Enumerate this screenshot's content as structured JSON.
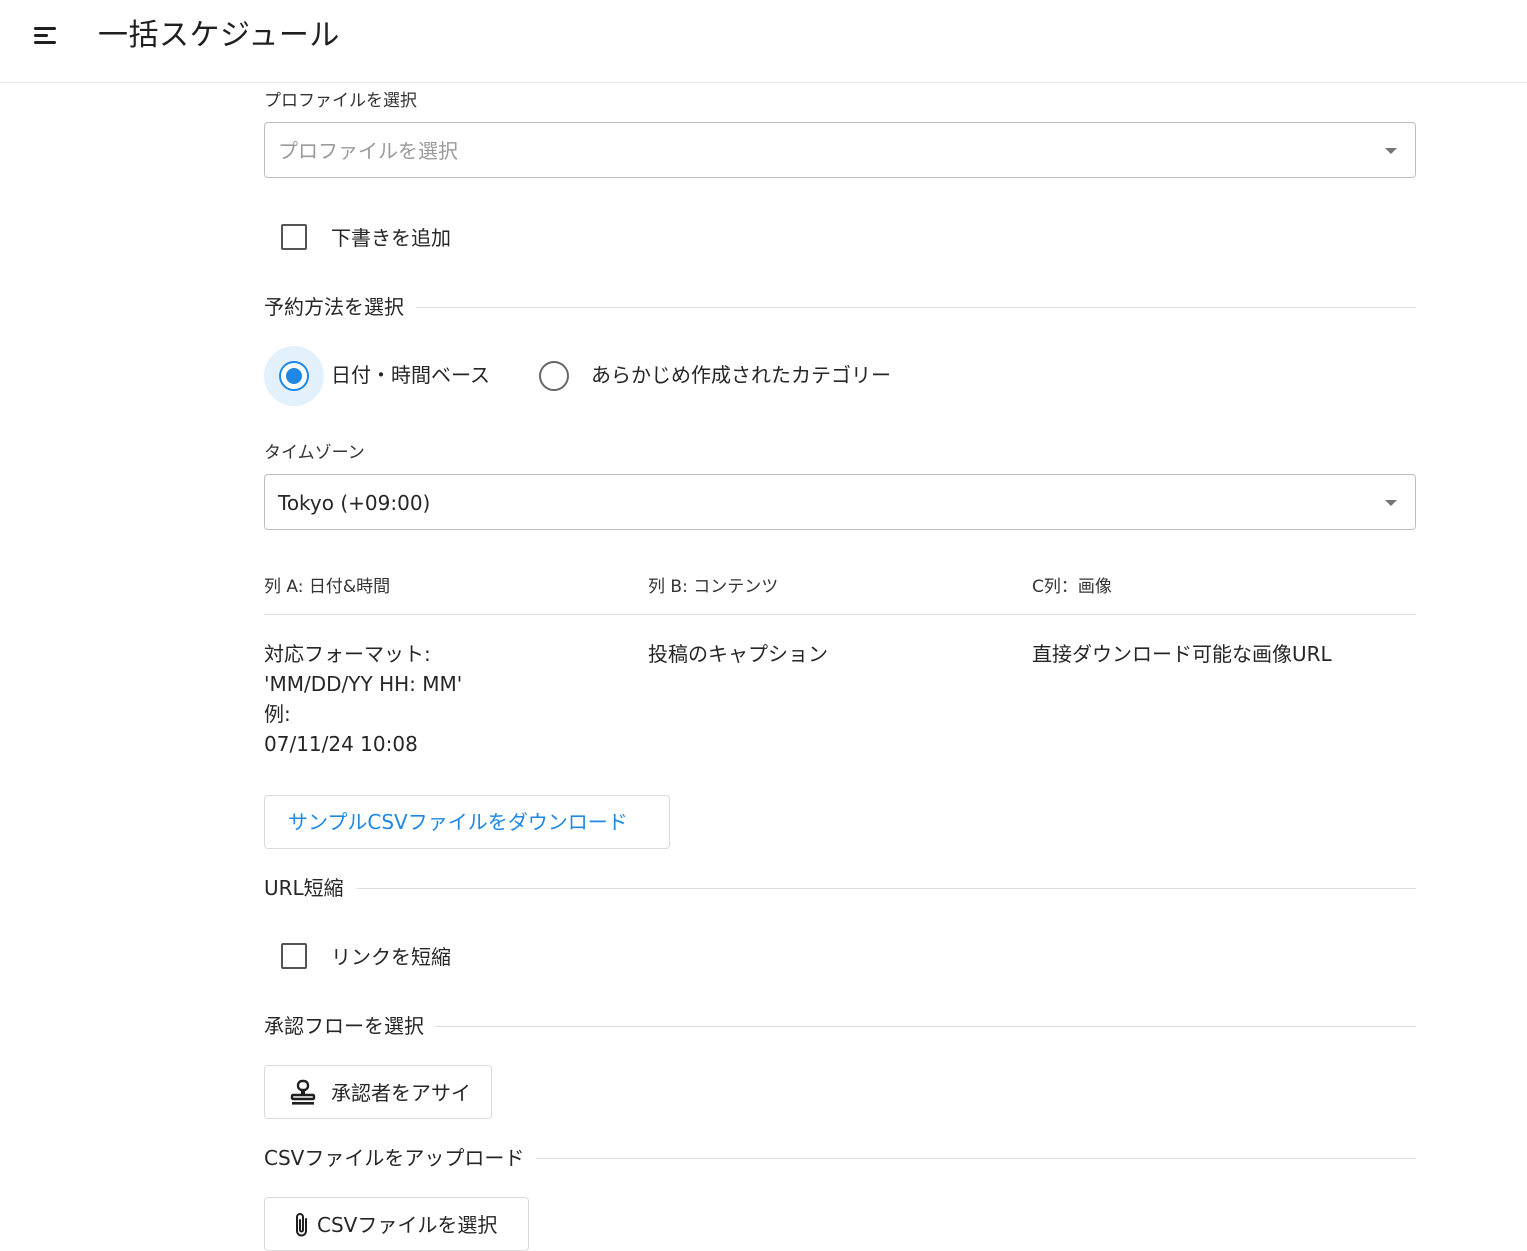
{
  "header": {
    "title": "一括スケジュール",
    "menu_icon": "menu-icon"
  },
  "profile": {
    "label": "プロファイルを選択",
    "placeholder": "プロファイルを選択"
  },
  "draft": {
    "label": "下書きを追加",
    "checked": false
  },
  "schedule_method": {
    "title": "予約方法を選択",
    "options": [
      {
        "label": "日付・時間ベース",
        "selected": true
      },
      {
        "label": "あらかじめ作成されたカテゴリー",
        "selected": false
      }
    ]
  },
  "timezone": {
    "label": "タイムゾーン",
    "value": "Tokyo (+09:00)"
  },
  "columns": [
    {
      "header": "列 A: 日付&時間",
      "lines": [
        "対応フォーマット:",
        "'MM/DD/YY HH: MM'",
        "例:",
        "07/11/24 10:08"
      ]
    },
    {
      "header": "列 B: コンテンツ",
      "lines": [
        "投稿のキャプション"
      ]
    },
    {
      "header": "C列：画像",
      "lines": [
        "直接ダウンロード可能な画像URL"
      ]
    }
  ],
  "sample_csv_button": "サンプルCSVファイルをダウンロード",
  "url_shorten": {
    "title": "URL短縮",
    "checkbox_label": "リンクを短縮",
    "checked": false
  },
  "approval": {
    "title": "承認フローを選択",
    "button_label": "承認者をアサイン",
    "button_icon": "stamp-icon"
  },
  "csv_upload": {
    "title": "CSVファイルをアップロード",
    "button_label": "CSVファイルを選択",
    "button_icon": "paperclip-icon"
  },
  "colors": {
    "accent": "#1e88e5",
    "radio_halo": "#e3f1fc",
    "divider": "#e0e0e0"
  }
}
